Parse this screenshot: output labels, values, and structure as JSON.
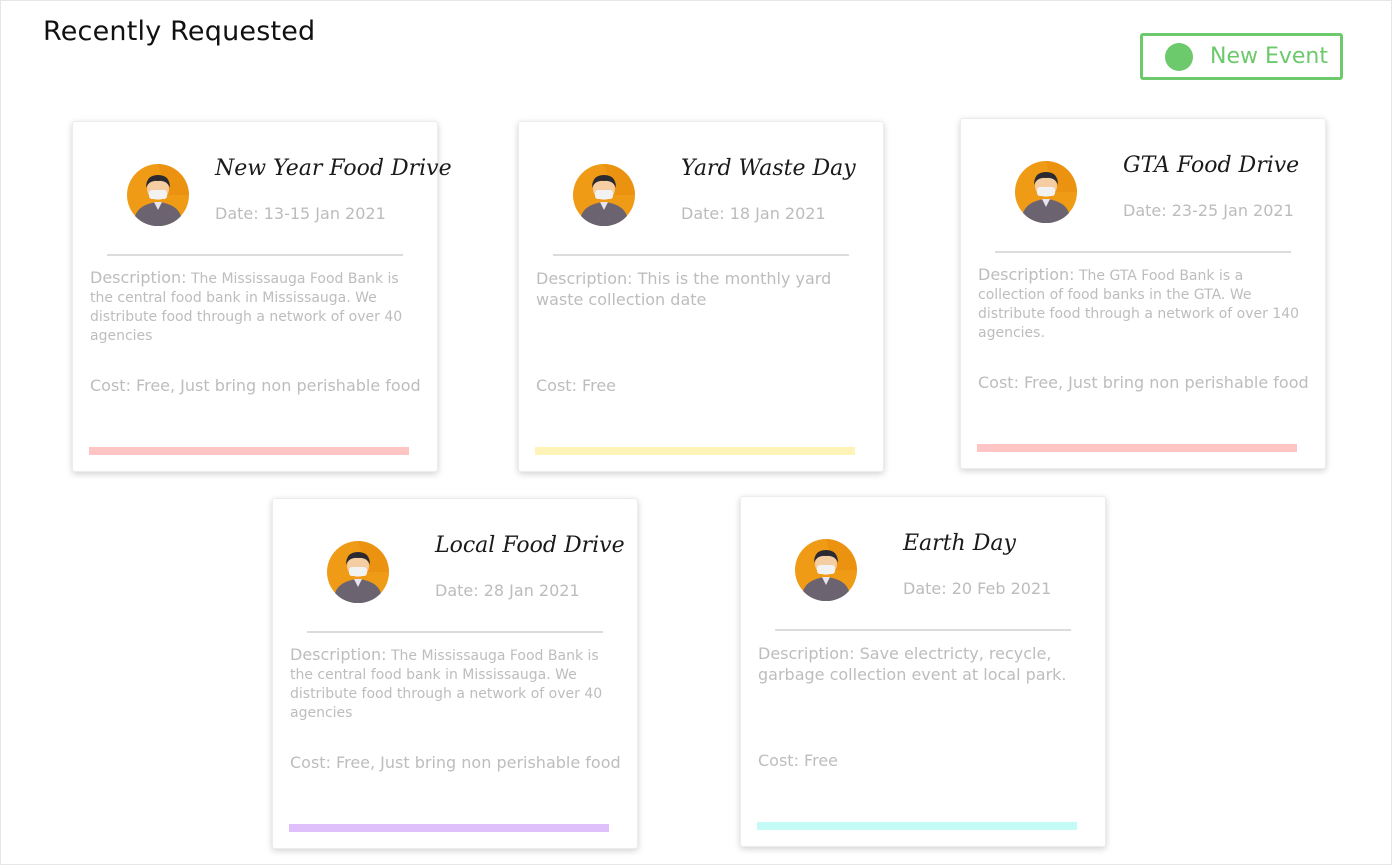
{
  "header": {
    "title": "Recently Requested",
    "new_event_label": "New Event",
    "accent": "#6cc96c"
  },
  "cards": [
    {
      "title": "New Year Food Drive",
      "date": "Date: 13-15 Jan 2021",
      "description_label": "Description:",
      "description": "The Mississauga Food Bank is the central food bank in Mississauga. We distribute food through a network of over 40 agencies",
      "cost": "Cost: Free, Just bring non perishable food",
      "bar_color": "#ffc4c4",
      "avatar_icon": "masked-person-icon"
    },
    {
      "title": "Yard Waste Day",
      "date": "Date: 18 Jan 2021",
      "description_label": "Description:",
      "description": "This is the monthly yard waste collection date",
      "cost": "Cost: Free",
      "bar_color": "#fff4b8",
      "avatar_icon": "masked-person-icon"
    },
    {
      "title": "GTA Food Drive",
      "date": "Date: 23-25 Jan 2021",
      "description_label": "Description:",
      "description": "The GTA Food Bank is a collection of food banks in the GTA. We distribute food through a network of over 140 agencies.",
      "cost": "Cost: Free, Just bring non perishable food",
      "bar_color": "#ffc4c4",
      "avatar_icon": "masked-person-icon"
    },
    {
      "title": "Local Food Drive",
      "date": "Date: 28 Jan 2021",
      "description_label": "Description:",
      "description": "The Mississauga Food Bank is the central food bank in Mississauga. We distribute food through a network of over 40 agencies",
      "cost": "Cost: Free, Just bring non perishable food",
      "bar_color": "#dfc0fb",
      "avatar_icon": "masked-person-icon"
    },
    {
      "title": "Earth Day",
      "date": "Date:  20 Feb 2021",
      "description_label": "Description:",
      "description": "Save electricty, recycle, garbage collection event at local park.",
      "cost": "Cost: Free",
      "bar_color": "#c4fbf7",
      "avatar_icon": "masked-person-icon"
    }
  ]
}
